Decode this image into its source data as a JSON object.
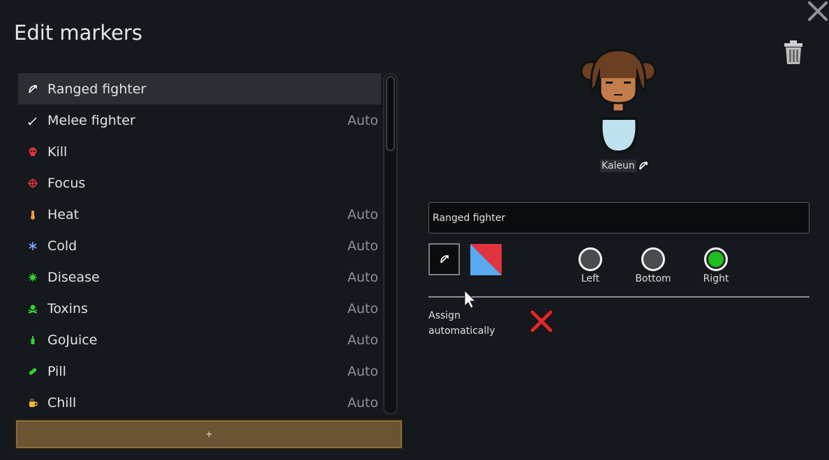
{
  "window": {
    "title": "Edit markers",
    "close_icon": "close-icon",
    "delete_icon": "trash-icon"
  },
  "markers": [
    {
      "label": "Ranged fighter",
      "icon": "bow-icon",
      "color": "#ffffff",
      "auto": ""
    },
    {
      "label": "Melee fighter",
      "icon": "sword-icon",
      "color": "#ffffff",
      "auto": "Auto"
    },
    {
      "label": "Kill",
      "icon": "skull-icon",
      "color": "#e03535",
      "auto": ""
    },
    {
      "label": "Focus",
      "icon": "crosshair-icon",
      "color": "#e03535",
      "auto": ""
    },
    {
      "label": "Heat",
      "icon": "thermometer-icon",
      "color": "#f29a3a",
      "auto": "Auto"
    },
    {
      "label": "Cold",
      "icon": "snowflake-icon",
      "color": "#7ea7ff",
      "auto": "Auto"
    },
    {
      "label": "Disease",
      "icon": "germ-icon",
      "color": "#2fd62f",
      "auto": "Auto"
    },
    {
      "label": "Toxins",
      "icon": "skull-crossbones-icon",
      "color": "#2fd62f",
      "auto": "Auto"
    },
    {
      "label": "GoJuice",
      "icon": "bottle-icon",
      "color": "#2fd62f",
      "auto": "Auto"
    },
    {
      "label": "Pill",
      "icon": "pill-icon",
      "color": "#2fd62f",
      "auto": "Auto"
    },
    {
      "label": "Chill",
      "icon": "cup-icon",
      "color": "#f2b73a",
      "auto": "Auto"
    }
  ],
  "add_button": {
    "label": "+"
  },
  "pawn": {
    "name": "Kaleun",
    "marker_icon": "bow-icon"
  },
  "editor": {
    "name_value": "Ranged fighter",
    "icon": "bow-icon",
    "swatch_colors": [
      "#5aaaf2",
      "#e0353f"
    ],
    "positions": [
      {
        "label": "Left",
        "selected": false
      },
      {
        "label": "Bottom",
        "selected": false
      },
      {
        "label": "Right",
        "selected": true
      }
    ],
    "assign_label": "Assign automatically",
    "assign_state": "off",
    "assign_icon": "red-x-icon"
  }
}
